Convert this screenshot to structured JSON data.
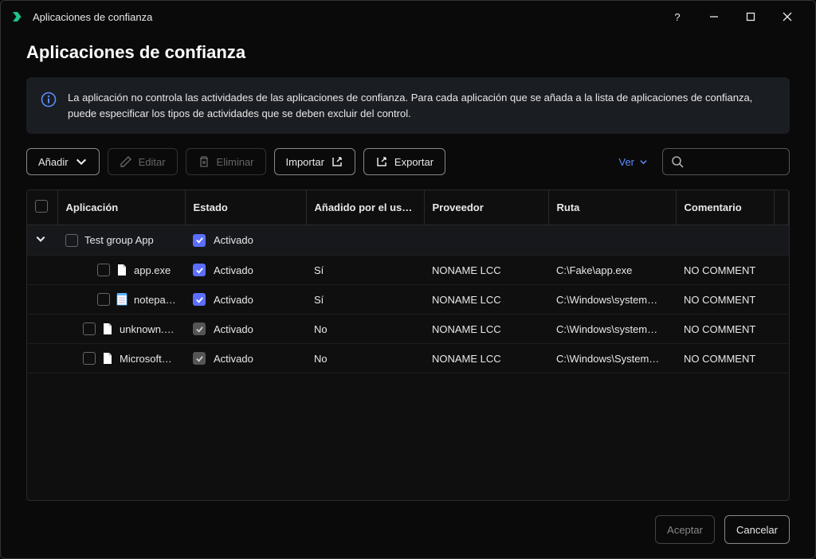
{
  "window": {
    "title": "Aplicaciones de confianza"
  },
  "page": {
    "title": "Aplicaciones de confianza",
    "info": "La aplicación no controla las actividades de las aplicaciones de confianza. Para cada aplicación que se añada a la lista de aplicaciones de confianza, puede especificar los tipos de actividades que se deben excluir del control."
  },
  "toolbar": {
    "add": "Añadir",
    "edit": "Editar",
    "delete": "Eliminar",
    "import": "Importar",
    "export": "Exportar",
    "view": "Ver",
    "search_placeholder": ""
  },
  "columns": {
    "app": "Aplicación",
    "state": "Estado",
    "added": "Añadido por el us…",
    "vendor": "Proveedor",
    "path": "Ruta",
    "comment": "Comentario"
  },
  "group": {
    "name": "Test group App",
    "state": "Activado"
  },
  "rows": [
    {
      "name": "app.exe",
      "state": "Activado",
      "added": "Sí",
      "vendor": "NONAME LCC",
      "path": "C:\\Fake\\app.exe",
      "comment": "NO COMMENT",
      "child": true,
      "icon": "file",
      "checked": true
    },
    {
      "name": "notepa…",
      "state": "Activado",
      "added": "Sí",
      "vendor": "NONAME LCC",
      "path": "C:\\Windows\\system…",
      "comment": "NO COMMENT",
      "child": true,
      "icon": "notepad",
      "checked": true
    },
    {
      "name": "unknown.…",
      "state": "Activado",
      "added": "No",
      "vendor": "NONAME LCC",
      "path": "C:\\Windows\\system…",
      "comment": "NO COMMENT",
      "child": false,
      "icon": "file",
      "checked": false
    },
    {
      "name": "Microsoft…",
      "state": "Activado",
      "added": "No",
      "vendor": "NONAME LCC",
      "path": "C:\\Windows\\System…",
      "comment": "NO COMMENT",
      "child": false,
      "icon": "file",
      "checked": false
    }
  ],
  "footer": {
    "accept": "Aceptar",
    "cancel": "Cancelar"
  }
}
